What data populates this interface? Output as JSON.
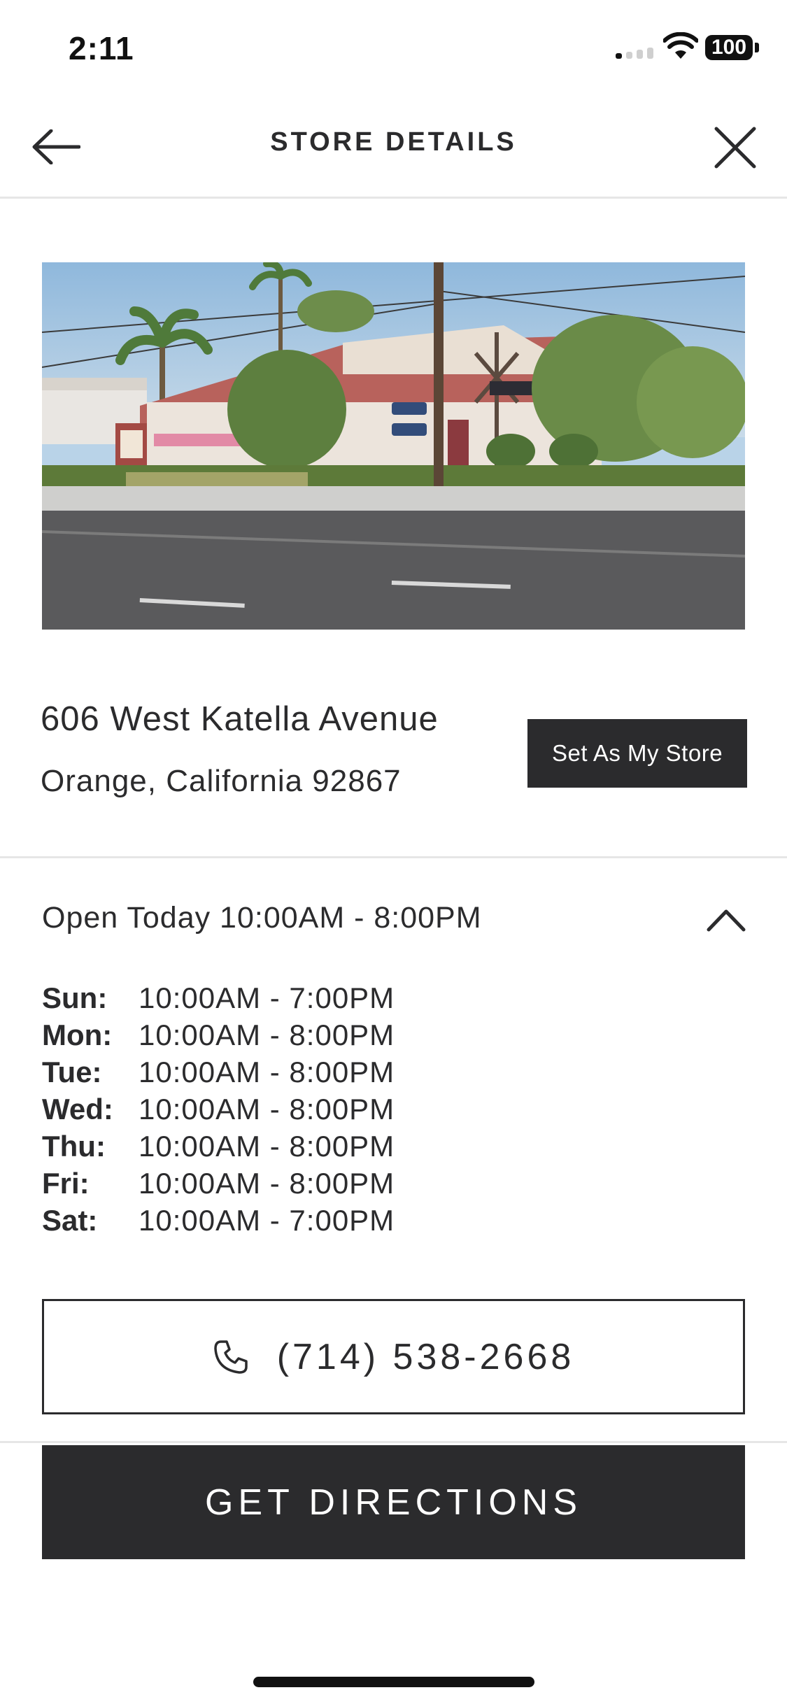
{
  "status_bar": {
    "time": "2:11",
    "battery": "100"
  },
  "header": {
    "title": "STORE DETAILS"
  },
  "store": {
    "address_line1": "606 West Katella Avenue",
    "address_line2": "Orange, California 92867",
    "set_store_label": "Set As My Store"
  },
  "hours": {
    "open_today": "Open Today 10:00AM - 8:00PM",
    "days": [
      {
        "day": "Sun:",
        "time": "10:00AM - 7:00PM"
      },
      {
        "day": "Mon:",
        "time": "10:00AM - 8:00PM"
      },
      {
        "day": "Tue:",
        "time": "10:00AM - 8:00PM"
      },
      {
        "day": "Wed:",
        "time": "10:00AM - 8:00PM"
      },
      {
        "day": "Thu:",
        "time": "10:00AM - 8:00PM"
      },
      {
        "day": "Fri:",
        "time": "10:00AM - 8:00PM"
      },
      {
        "day": "Sat:",
        "time": "10:00AM - 7:00PM"
      }
    ]
  },
  "actions": {
    "phone": "(714) 538-2668",
    "directions_label": "GET DIRECTIONS"
  },
  "icons": {
    "back": "arrow-left-icon",
    "close": "close-icon",
    "collapse": "chevron-up-icon",
    "phone": "phone-icon"
  },
  "colors": {
    "primary_dark": "#2b2b2d",
    "divider": "#e6e6e6",
    "background": "#ffffff"
  }
}
